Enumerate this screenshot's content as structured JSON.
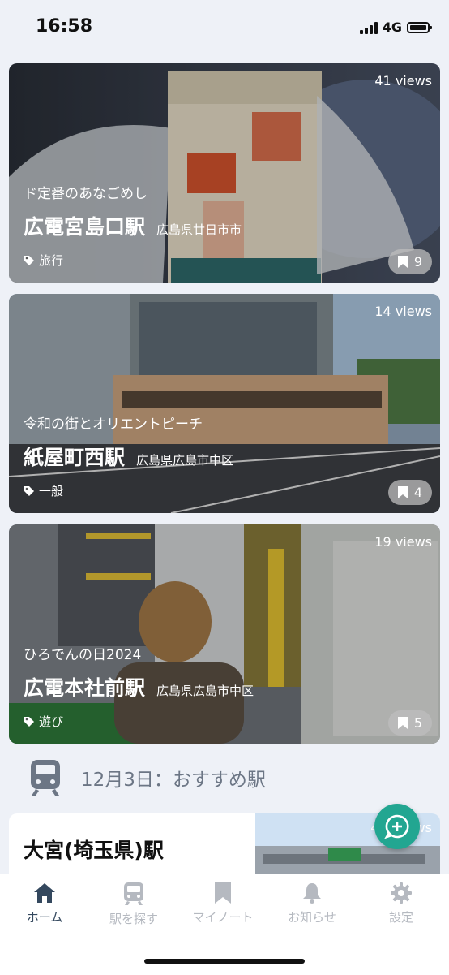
{
  "status": {
    "time": "16:58",
    "network": "4G"
  },
  "cards": [
    {
      "views": "41 views",
      "subtitle": "ド定番のあなごめし",
      "station": "広電宮島口駅",
      "address": "広島県廿日市市",
      "tag": "旅行",
      "bookmarks": "9"
    },
    {
      "views": "14 views",
      "subtitle": "令和の街とオリエントピーチ",
      "station": "紙屋町西駅",
      "address": "広島県広島市中区",
      "tag": "一般",
      "bookmarks": "4"
    },
    {
      "views": "19 views",
      "subtitle": "ひろでんの日2024",
      "station": "広電本社前駅",
      "address": "広島県広島市中区",
      "tag": "遊び",
      "bookmarks": "5"
    }
  ],
  "section": {
    "title": "12月3日：おすすめ駅",
    "icon": "train-icon"
  },
  "recommended": {
    "title": "大宮(埼玉県)駅",
    "views": "4,6  views"
  },
  "tabs": [
    {
      "label": "ホーム",
      "icon": "home-icon"
    },
    {
      "label": "駅を探す",
      "icon": "train-icon"
    },
    {
      "label": "マイノート",
      "icon": "bookmark-icon"
    },
    {
      "label": "お知らせ",
      "icon": "bell-icon"
    },
    {
      "label": "設定",
      "icon": "gear-icon"
    }
  ],
  "colors": {
    "accent": "#22a691",
    "tab_active": "#34485e",
    "tab_inactive": "#b5b9c0",
    "background": "#eef1f7"
  }
}
